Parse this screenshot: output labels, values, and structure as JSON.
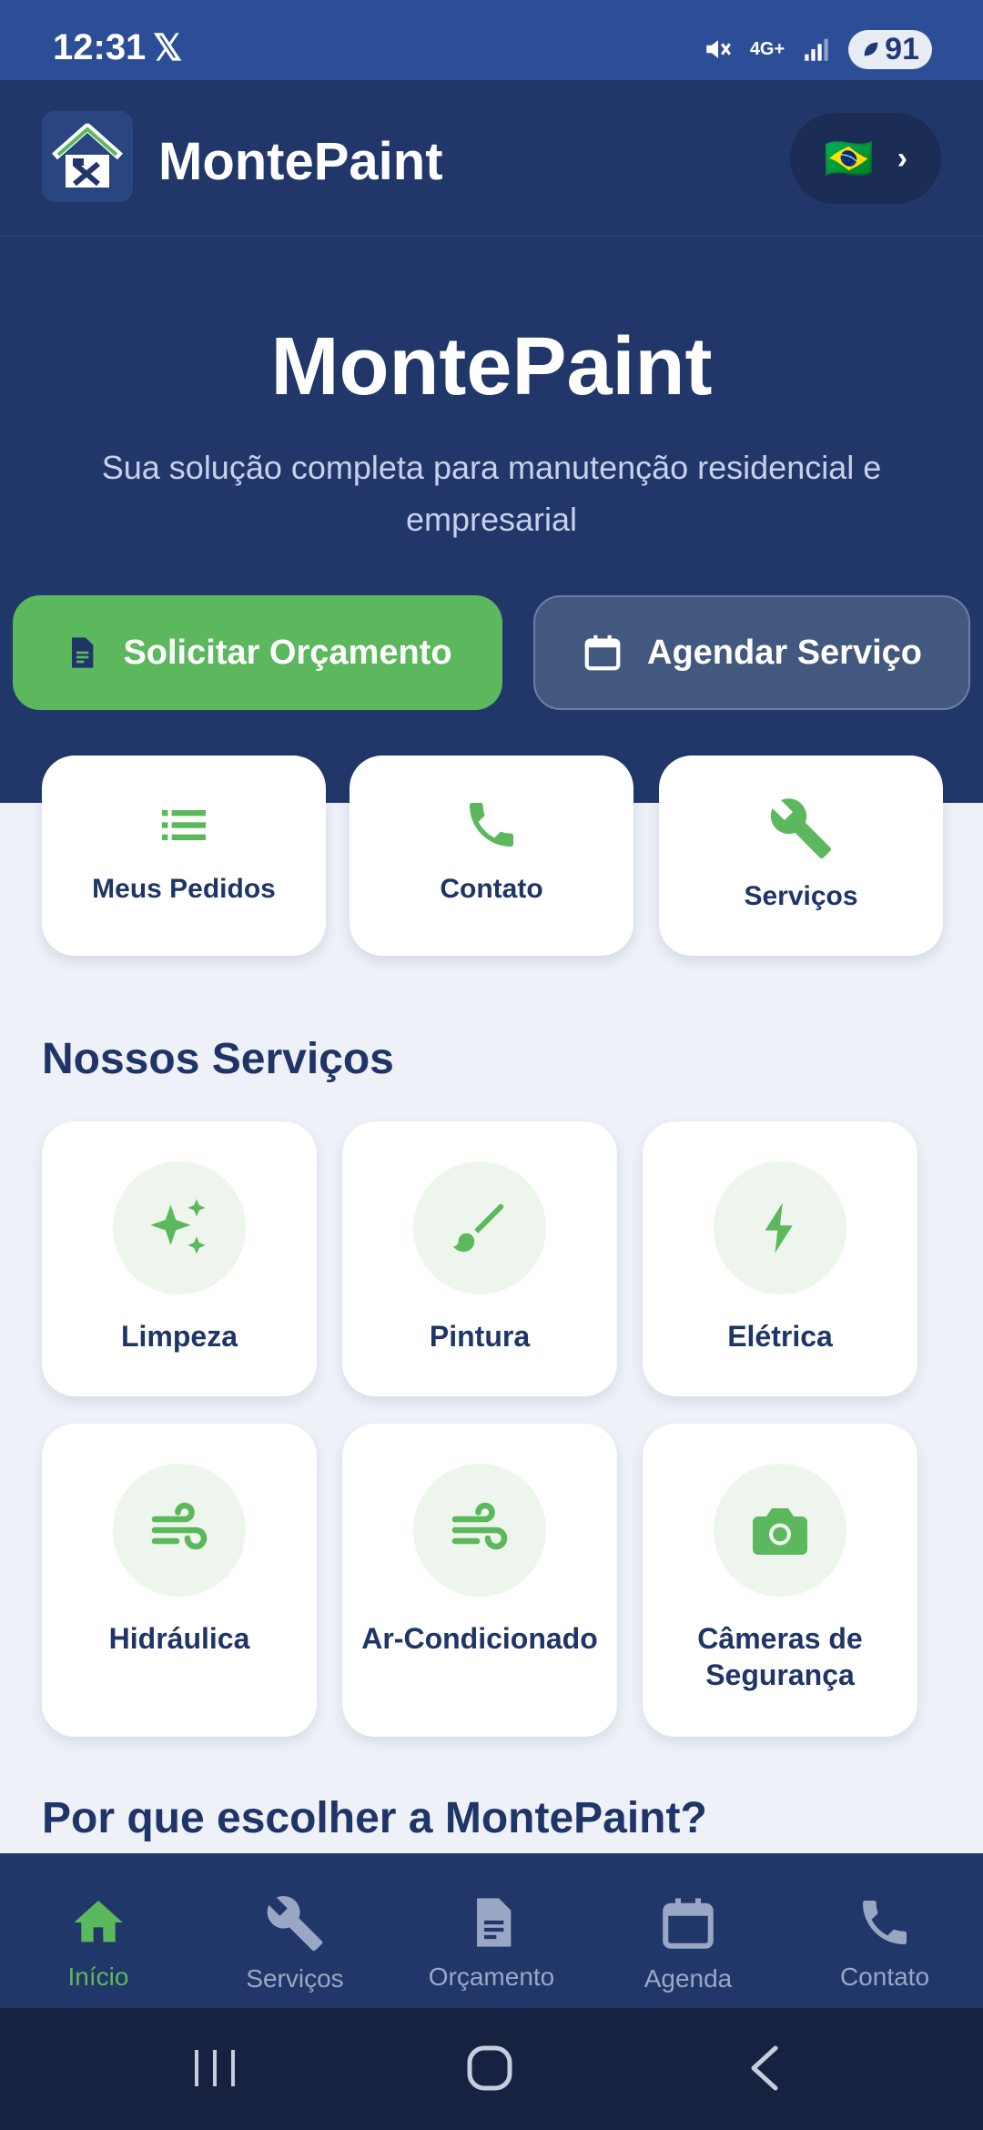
{
  "status_bar": {
    "time": "12:31",
    "x_label": "𝕏",
    "network": "4G+",
    "battery": "91"
  },
  "header": {
    "app_name": "MontePaint",
    "language_flag": "🇧🇷",
    "language_chevron": "›"
  },
  "hero": {
    "title": "MontePaint",
    "subtitle": "Sua solução completa para manutenção residencial e empresarial",
    "primary_button": "Solicitar Orçamento",
    "secondary_button": "Agendar Serviço"
  },
  "quick_actions": [
    {
      "label": "Meus Pedidos",
      "icon": "list-icon"
    },
    {
      "label": "Contato",
      "icon": "phone-icon"
    },
    {
      "label": "Serviços",
      "icon": "wrench-icon"
    }
  ],
  "services_section": {
    "title": "Nossos Serviços",
    "items": [
      {
        "label": "Limpeza",
        "icon": "sparkle-icon"
      },
      {
        "label": "Pintura",
        "icon": "paintbrush-icon"
      },
      {
        "label": "Elétrica",
        "icon": "bolt-icon"
      },
      {
        "label": "Hidráulica",
        "icon": "wind-icon"
      },
      {
        "label": "Ar-Condicionado",
        "icon": "wind-icon"
      },
      {
        "label": "Câmeras de Segurança",
        "icon": "camera-icon"
      }
    ]
  },
  "why_section": {
    "title": "Por que escolher a MontePaint?"
  },
  "bottom_nav": [
    {
      "label": "Início",
      "icon": "home-icon",
      "active": true
    },
    {
      "label": "Serviços",
      "icon": "wrench-icon",
      "active": false
    },
    {
      "label": "Orçamento",
      "icon": "document-icon",
      "active": false
    },
    {
      "label": "Agenda",
      "icon": "calendar-icon",
      "active": false
    },
    {
      "label": "Contato",
      "icon": "phone-icon",
      "active": false
    }
  ],
  "colors": {
    "navy": "#21376a",
    "accent_green": "#5cb85c",
    "text_dark": "#1f3568",
    "background": "#eef1f7"
  }
}
